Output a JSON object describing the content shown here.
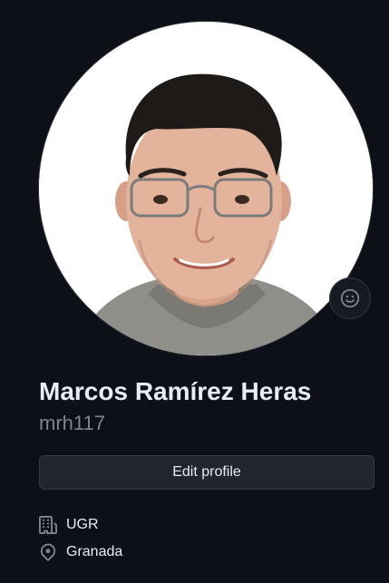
{
  "profile": {
    "full_name": "Marcos Ramírez Heras",
    "username": "mrh117",
    "avatar_icon": "avatar-photo",
    "status_icon": "smiley-icon",
    "edit_button_label": "Edit profile",
    "details": {
      "organization": {
        "icon": "organization-icon",
        "label": "UGR"
      },
      "location": {
        "icon": "location-icon",
        "label": "Granada"
      }
    }
  },
  "colors": {
    "background": "#0d1117",
    "text_primary": "#e6edf3",
    "text_muted": "#7d8590",
    "button_bg": "#21262d",
    "border": "#30363d"
  }
}
